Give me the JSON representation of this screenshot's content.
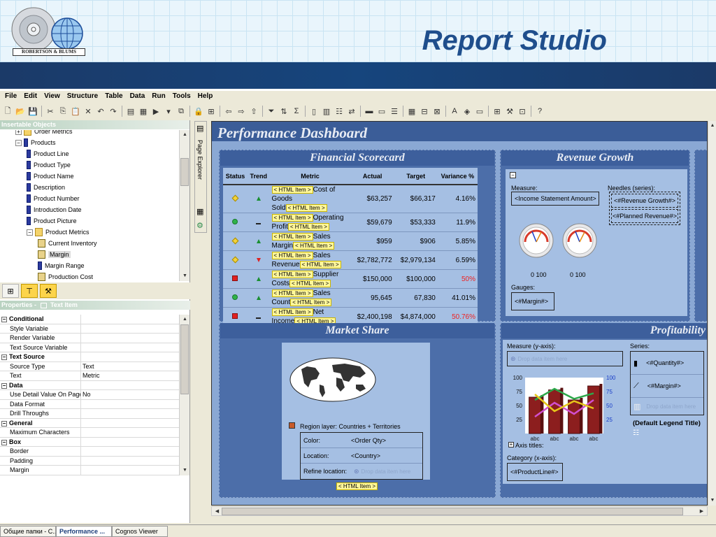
{
  "slide": {
    "title": "Report Studio",
    "logo_text": "ROBERTSON & BLUMS"
  },
  "menu": [
    "File",
    "Edit",
    "View",
    "Structure",
    "Table",
    "Data",
    "Run",
    "Tools",
    "Help"
  ],
  "left_panel": {
    "insertable_title": "Insertable Objects",
    "tree": [
      {
        "label": "Order Metrics",
        "level": 1,
        "icon": "folder-icon"
      },
      {
        "label": "Products",
        "level": 1,
        "icon": "query-subject-icon"
      },
      {
        "label": "Product Line",
        "level": 2,
        "icon": "query-item-icon"
      },
      {
        "label": "Product Type",
        "level": 2,
        "icon": "query-item-icon"
      },
      {
        "label": "Product Name",
        "level": 2,
        "icon": "query-item-icon"
      },
      {
        "label": "Description",
        "level": 2,
        "icon": "query-item-icon"
      },
      {
        "label": "Product Number",
        "level": 2,
        "icon": "query-item-icon"
      },
      {
        "label": "Introduction Date",
        "level": 2,
        "icon": "query-item-icon"
      },
      {
        "label": "Product Picture",
        "level": 2,
        "icon": "query-item-icon"
      },
      {
        "label": "Product Metrics",
        "level": 2,
        "icon": "folder-icon"
      },
      {
        "label": "Current Inventory",
        "level": 3,
        "icon": "measure-icon"
      },
      {
        "label": "Margin",
        "level": 3,
        "icon": "measure-icon"
      },
      {
        "label": "Margin Range",
        "level": 3,
        "icon": "query-item-icon"
      },
      {
        "label": "Production Cost",
        "level": 3,
        "icon": "measure-icon"
      }
    ],
    "properties_title": "Properties -",
    "properties_subtitle": "Text Item",
    "properties": [
      {
        "section": "Conditional"
      },
      {
        "key": "Style Variable",
        "value": ""
      },
      {
        "key": "Render Variable",
        "value": ""
      },
      {
        "key": "Text Source Variable",
        "value": ""
      },
      {
        "section": "Text Source"
      },
      {
        "key": "Source Type",
        "value": "Text"
      },
      {
        "key": "Text",
        "value": "Metric"
      },
      {
        "section": "Data"
      },
      {
        "key": "Use Detail Value On Page",
        "value": "No"
      },
      {
        "key": "Data Format",
        "value": ""
      },
      {
        "key": "Drill Throughs",
        "value": ""
      },
      {
        "section": "General"
      },
      {
        "key": "Maximum Characters",
        "value": ""
      },
      {
        "section": "Box"
      },
      {
        "key": "Border",
        "value": ""
      },
      {
        "key": "Padding",
        "value": ""
      },
      {
        "key": "Margin",
        "value": ""
      }
    ]
  },
  "explorer_label": "Page Explorer",
  "canvas": {
    "dashboard_title": "Performance Dashboard",
    "financial": {
      "title": "Financial Scorecard",
      "headers": [
        "Status",
        "Trend",
        "Metric",
        "Actual",
        "Target",
        "Variance %"
      ],
      "html_item": "< HTML Item >",
      "rows": [
        {
          "status": "diamond",
          "trend": "up",
          "metric": "Cost of Goods Sold",
          "actual": "$63,257",
          "target": "$66,317",
          "variance": "4.16%",
          "neg": false
        },
        {
          "status": "circle",
          "trend": "flat",
          "metric": "Operating Profit",
          "actual": "$59,679",
          "target": "$53,333",
          "variance": "11.9%",
          "neg": false
        },
        {
          "status": "diamond",
          "trend": "up",
          "metric": "Sales Margin",
          "actual": "$959",
          "target": "$906",
          "variance": "5.85%",
          "neg": false
        },
        {
          "status": "diamond",
          "trend": "down",
          "metric": "Sales Revenue",
          "actual": "$2,782,772",
          "target": "$2,979,134",
          "variance": "6.59%",
          "neg": false
        },
        {
          "status": "square",
          "trend": "up",
          "metric": "Supplier Costs",
          "actual": "$150,000",
          "target": "$100,000",
          "variance": "50%",
          "neg": true
        },
        {
          "status": "circle",
          "trend": "up",
          "metric": "Sales Count",
          "actual": "95,645",
          "target": "67,830",
          "variance": "41.01%",
          "neg": false
        },
        {
          "status": "square",
          "trend": "flat",
          "metric": "Net Income",
          "actual": "$2,400,198",
          "target": "$4,874,000",
          "variance": "50.76%",
          "neg": true
        }
      ]
    },
    "revenue": {
      "title": "Revenue Growth",
      "measure_label": "Measure:",
      "measure_value": "<Income Statement Amount>",
      "needles_label": "Needles (series):",
      "needle1": "<#Revenue Growth#>",
      "needle2": "<#Planned Revenue#>",
      "gauge_axis": "0  100",
      "gauges_label": "Gauges:",
      "gauges_value": "<#Margin#>"
    },
    "market": {
      "title": "Market Share",
      "region_layer": "Region layer: Countries + Territories",
      "color_label": "Color:",
      "color_value": "<Order Qty>",
      "location_label": "Location:",
      "location_value": "<Country>",
      "refine_label": "Refine location:",
      "refine_placeholder": "Drop data item here",
      "html_item": "< HTML Item >"
    },
    "profitability": {
      "title": "Profitability",
      "measure_label": "Measure (y-axis):",
      "measure_placeholder": "Drop data item here",
      "series_label": "Series:",
      "series1": "<#Quantity#>",
      "series2": "<#Margin#>",
      "series_placeholder": "Drop data item here",
      "legend_title": "(Default Legend Title)",
      "axis_titles": "Axis titles:",
      "category_label": "Category (x-axis):",
      "category_value": "<#ProductLine#>",
      "left_ticks": [
        "100",
        "75",
        "50",
        "25"
      ],
      "right_ticks": [
        "100",
        "75",
        "50",
        "25"
      ],
      "x_labels": [
        "abc",
        "abc",
        "abc",
        "abc"
      ]
    }
  },
  "chart_data": {
    "type": "bar",
    "categories": [
      "abc",
      "abc",
      "abc",
      "abc"
    ],
    "series": [
      {
        "values": [
          65,
          78,
          60,
          85
        ]
      },
      {
        "values": [
          60,
          80,
          62,
          72
        ]
      }
    ],
    "ylim": [
      0,
      100
    ]
  },
  "taskbar": [
    "Общие папки - C...",
    "Performance ...",
    "Cognos Viewer"
  ],
  "colors": {
    "band": "#1b3a68",
    "title": "#1f4e8c",
    "canvas_bg": "#8aa8d4",
    "section_header": "#3d5f9c",
    "html_item": "#fff79a",
    "negative": "#e22"
  }
}
